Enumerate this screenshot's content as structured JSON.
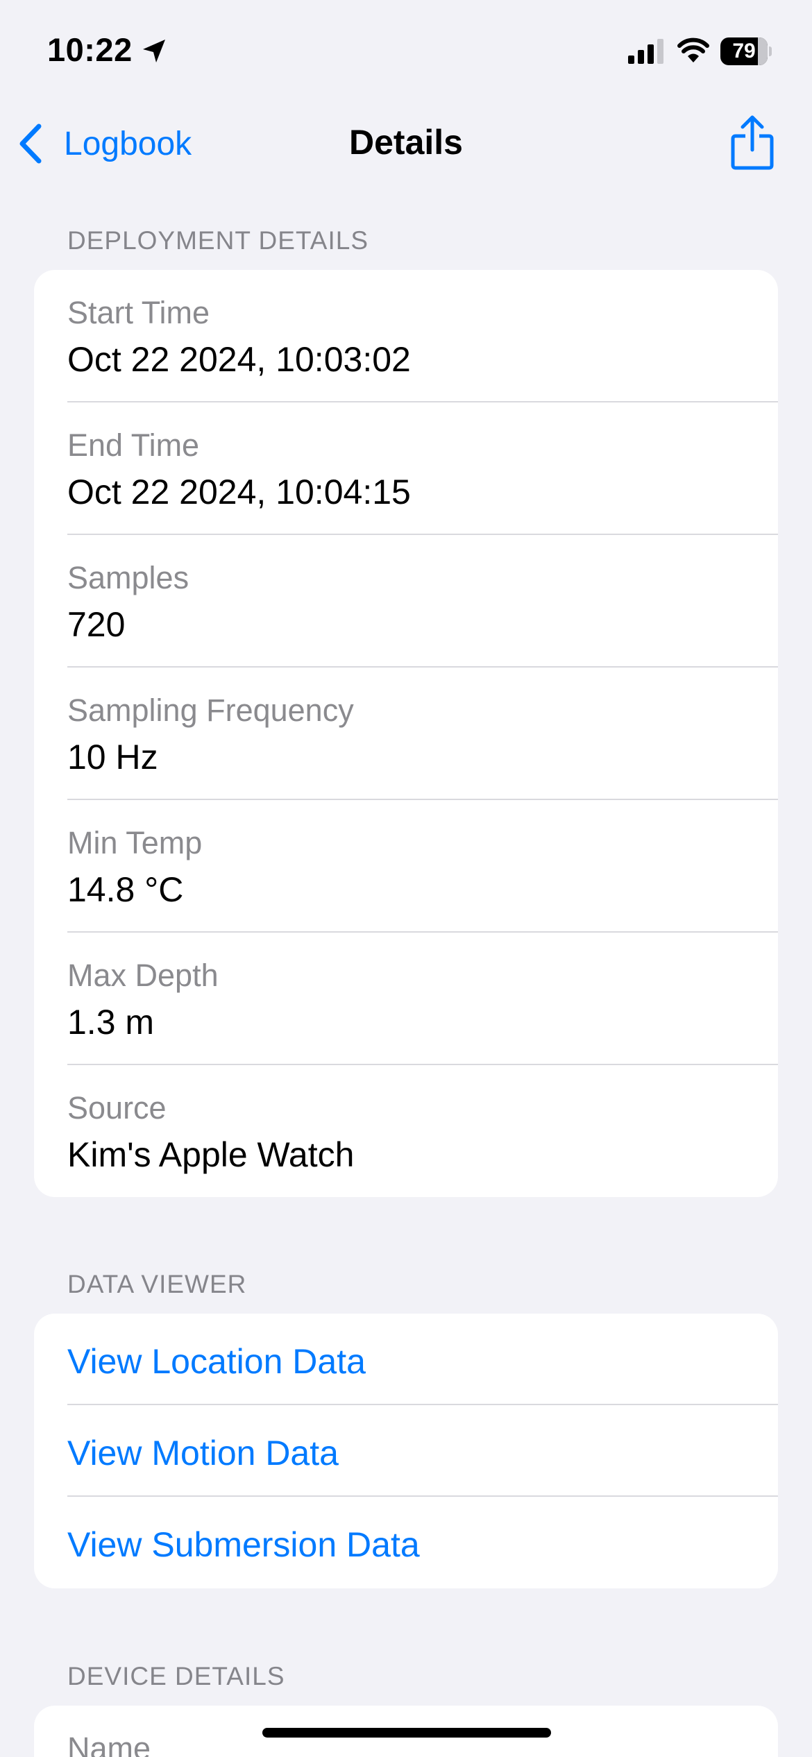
{
  "status_bar": {
    "time": "10:22",
    "battery_level": "79"
  },
  "nav": {
    "back_label": "Logbook",
    "title": "Details"
  },
  "deployment": {
    "header": "DEPLOYMENT DETAILS",
    "rows": [
      {
        "label": "Start Time",
        "value": "Oct 22 2024, 10:03:02"
      },
      {
        "label": "End Time",
        "value": "Oct 22 2024, 10:04:15"
      },
      {
        "label": "Samples",
        "value": "720"
      },
      {
        "label": "Sampling Frequency",
        "value": "10 Hz"
      },
      {
        "label": "Min Temp",
        "value": "14.8 °C"
      },
      {
        "label": "Max Depth",
        "value": "1.3 m"
      },
      {
        "label": "Source",
        "value": "Kim's Apple Watch"
      }
    ]
  },
  "data_viewer": {
    "header": "DATA VIEWER",
    "links": [
      {
        "label": "View Location Data"
      },
      {
        "label": "View Motion Data"
      },
      {
        "label": "View Submersion Data"
      }
    ]
  },
  "device": {
    "header": "DEVICE DETAILS",
    "rows": [
      {
        "label": "Name"
      }
    ]
  },
  "colors": {
    "accent": "#007aff",
    "background": "#f2f2f7",
    "secondary_text": "#8a8a8e"
  }
}
